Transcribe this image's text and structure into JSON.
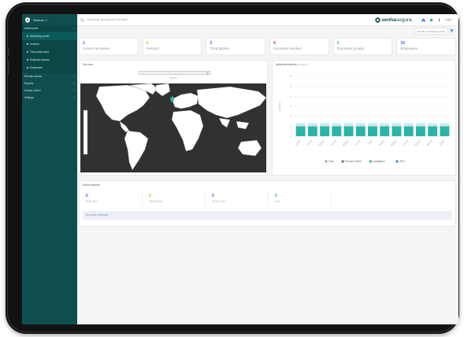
{
  "brand": {
    "name_bold": "senha",
    "name_thin": "segura",
    "accent": "#0f4e4e"
  },
  "sidebar": {
    "org": "Startum",
    "sections": [
      {
        "label": "Dashboards",
        "items": [
          "Monitoring center",
          "Vendors",
          "Third-party users",
          "Employee groups",
          "Employees"
        ]
      },
      {
        "label": "Remote access"
      },
      {
        "label": "Reports"
      },
      {
        "label": "Access control"
      },
      {
        "label": "Settings"
      }
    ]
  },
  "topbar": {
    "search_placeholder": "Credentials, pending and information",
    "language": "Login ~"
  },
  "filter": {
    "label": "Vendor or employee group"
  },
  "cards": [
    {
      "value": "1",
      "label": "Current accesses",
      "color": "#3a5bd9"
    },
    {
      "value": "2",
      "label": "Vendors",
      "color": "#e3b400"
    },
    {
      "value": "3",
      "label": "Third parties",
      "color": "#3a5bd9"
    },
    {
      "value": "4",
      "label": "Accesses revoked",
      "color": "#d9304a"
    },
    {
      "value": "2",
      "label": "Employee groups",
      "color": "#2db3a8"
    },
    {
      "value": "10",
      "label": "Employees",
      "color": "#3a5bd9"
    }
  ],
  "map_panel": {
    "title": "Vpn view",
    "select_label": "Country"
  },
  "chart_panel": {
    "title": "Authorized devices",
    "title_muted": "(Vendor)"
  },
  "chart_data": {
    "type": "bar",
    "ylabel": "Devices",
    "y_ticks": [
      "6",
      "5",
      "4",
      "3",
      "2",
      "1",
      "0"
    ],
    "categories": [
      "Jan/23",
      "Feb/23",
      "Mar/23",
      "Apr/23",
      "May/23",
      "Jun/23",
      "Jul/23",
      "Aug/23",
      "Sep/23",
      "Oct/23",
      "Nov/23",
      "Dec/23",
      "Jan/24"
    ],
    "series": [
      {
        "name": "Product Owner",
        "color": "#2db3a8",
        "values": [
          1,
          1,
          1,
          1,
          1,
          1,
          1,
          1,
          1,
          1,
          1,
          1,
          1
        ]
      },
      {
        "name": "Installation",
        "color": "#c9eceb",
        "values": [
          0.3,
          0.3,
          0.3,
          0.3,
          0.3,
          0.3,
          0.3,
          0.3,
          0.3,
          0.3,
          0.3,
          0.3,
          0.3
        ]
      }
    ],
    "legend": [
      "Total",
      "Product Owner",
      "Installation",
      "SDS"
    ],
    "legend_colors": [
      "#9aa3a6",
      "#6b7480",
      "#2db3a8",
      "#3a8fd9"
    ],
    "ylim": [
      0,
      6
    ]
  },
  "sessions": {
    "title": "Active sessions",
    "cards": [
      {
        "value": "0",
        "label": "RDP Web",
        "color": "#3a5bd9"
      },
      {
        "value": "0",
        "label": "SSH/Telnet",
        "color": "#e3b400"
      },
      {
        "value": "0",
        "label": "HTTP/ VNC",
        "color": "#3a5bd9"
      },
      {
        "value": "0",
        "label": "SSO",
        "color": "#2db3a8"
      }
    ],
    "empty": "No active sessions"
  }
}
